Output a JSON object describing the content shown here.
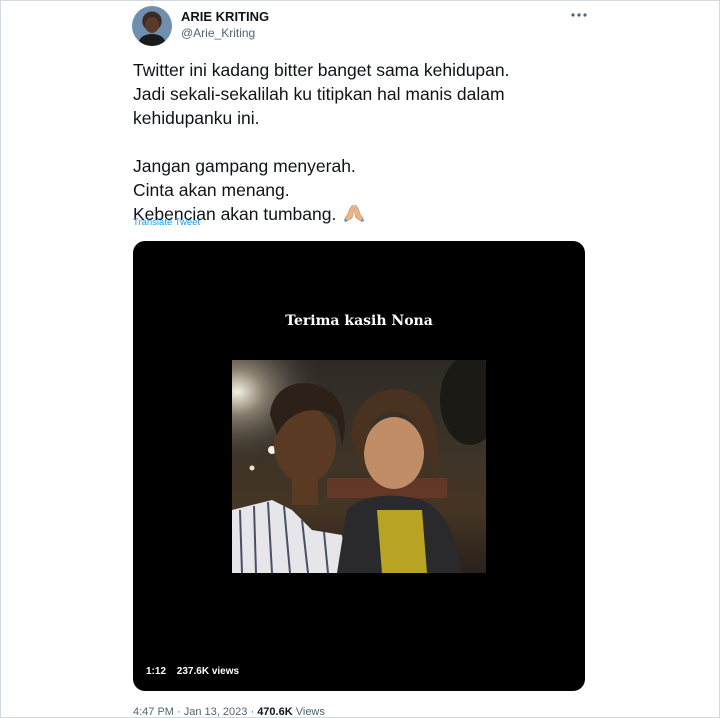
{
  "tweet": {
    "display_name": "ARIE KRITING",
    "handle": "@Arie_Kriting",
    "more_icon": "more-horizontal-icon",
    "text_lines_1": [
      "Twitter ini kadang bitter banget sama kehidupan.",
      "Jadi sekali-sekalilah ku titipkan hal manis dalam",
      "kehidupanku ini."
    ],
    "text_lines_2": [
      "Jangan gampang menyerah.",
      "Cinta akan menang.",
      "Kebencian akan tumbang."
    ],
    "emoji": "folded-hands-icon",
    "translate_label": "Translate Tweet",
    "media": {
      "caption": "Terima kasih Nona",
      "duration": "1:12",
      "views": "237.6K views"
    },
    "footer": {
      "time": "4:47 PM",
      "separator": "·",
      "date": "Jan 13, 2023",
      "view_count": "470.6K",
      "views_label": "Views"
    }
  }
}
